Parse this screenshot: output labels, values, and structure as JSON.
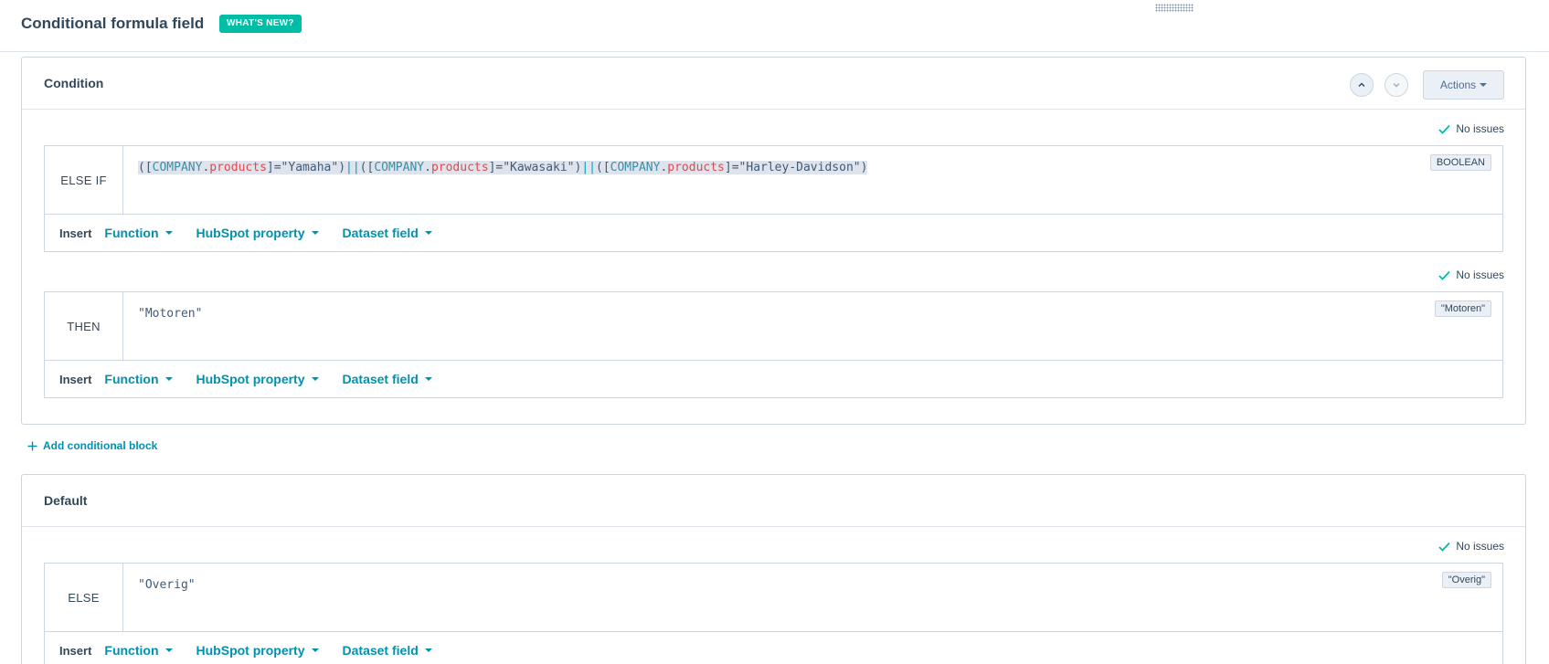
{
  "header": {
    "title": "Conditional formula field",
    "whats_new": "WHAT'S NEW?"
  },
  "condition_card": {
    "title": "Condition",
    "actions_label": "Actions",
    "else_if": {
      "status": "No issues",
      "label": "ELSE IF",
      "code_tokens": [
        {
          "t": "(",
          "c": "paren"
        },
        {
          "t": "[",
          "c": "paren"
        },
        {
          "t": "COMPANY",
          "c": "ref"
        },
        {
          "t": ".",
          "c": "paren"
        },
        {
          "t": "products",
          "c": "prop"
        },
        {
          "t": "]",
          "c": "paren"
        },
        {
          "t": "=\"Yamaha\"",
          "c": "str"
        },
        {
          "t": ")",
          "c": "paren"
        },
        {
          "t": "||",
          "c": "op"
        },
        {
          "t": "(",
          "c": "paren"
        },
        {
          "t": "[",
          "c": "paren"
        },
        {
          "t": "COMPANY",
          "c": "ref"
        },
        {
          "t": ".",
          "c": "paren"
        },
        {
          "t": "products",
          "c": "prop"
        },
        {
          "t": "]",
          "c": "paren"
        },
        {
          "t": "=\"Kawasaki\"",
          "c": "str"
        },
        {
          "t": ")",
          "c": "paren"
        },
        {
          "t": "||",
          "c": "op"
        },
        {
          "t": "(",
          "c": "paren"
        },
        {
          "t": "[",
          "c": "paren"
        },
        {
          "t": "COMPANY",
          "c": "ref"
        },
        {
          "t": ".",
          "c": "paren"
        },
        {
          "t": "products",
          "c": "prop"
        },
        {
          "t": "]",
          "c": "paren"
        },
        {
          "t": "=\"Harley-Davidson\"",
          "c": "str"
        },
        {
          "t": ")",
          "c": "paren"
        }
      ],
      "type_badge": "BOOLEAN",
      "insert_label": "Insert",
      "menus": [
        "Function",
        "HubSpot property",
        "Dataset field"
      ]
    },
    "then": {
      "status": "No issues",
      "label": "THEN",
      "code": "\"Motoren\"",
      "type_badge": "\"Motoren\"",
      "insert_label": "Insert",
      "menus": [
        "Function",
        "HubSpot property",
        "Dataset field"
      ]
    }
  },
  "add_block_label": "Add conditional block",
  "default_card": {
    "title": "Default",
    "else": {
      "status": "No issues",
      "label": "ELSE",
      "code": "\"Overig\"",
      "type_badge": "\"Overig\"",
      "insert_label": "Insert",
      "menus": [
        "Function",
        "HubSpot property",
        "Dataset field"
      ]
    }
  },
  "colors": {
    "accent": "#0091ae",
    "badge": "#00bda5",
    "check": "#00bda5",
    "property": "#d94c53",
    "reference": "#3b8fa8"
  },
  "icons": {
    "collapse": "chevron-up-icon",
    "expand": "chevron-down-icon",
    "status": "check-icon",
    "add": "plus-icon",
    "drag": "drag-handle-icon"
  }
}
